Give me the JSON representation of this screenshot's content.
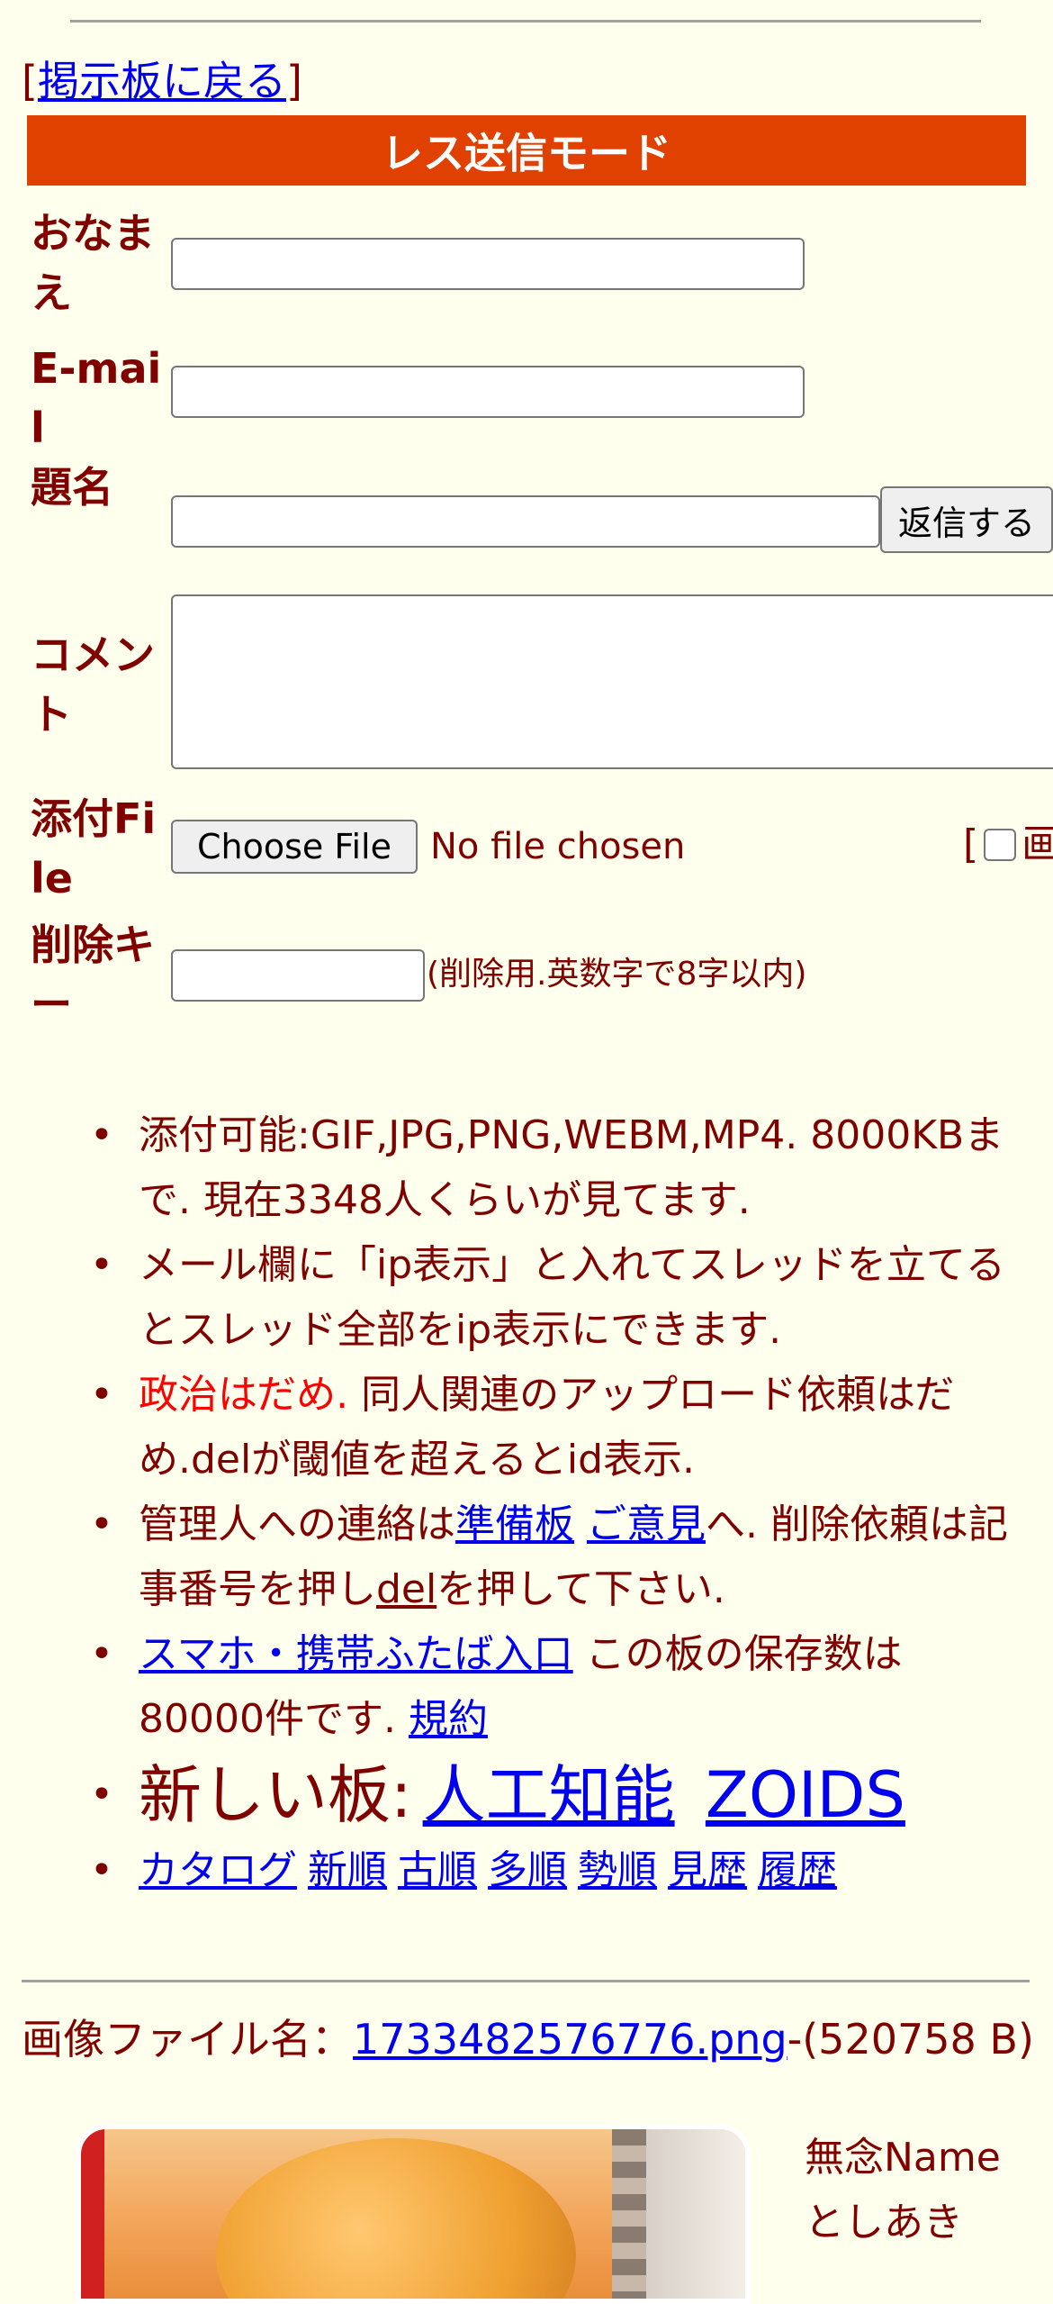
{
  "nav": {
    "back_open": "[",
    "back_link": "掲示板に戻る",
    "back_close": "]"
  },
  "mode_title": "レス送信モード",
  "form": {
    "name_label": "おなまえ",
    "email_label": "E-mail",
    "subject_label": "題名",
    "submit_label": "返信する",
    "comment_label": "コメント",
    "file_label": "添付File",
    "choose_file_label": "Choose File",
    "file_status": "No file chosen",
    "option_bracket": "[",
    "option_text": "画",
    "delete_key_label": "削除キー",
    "delete_key_hint": "(削除用.英数字で8字以内)"
  },
  "notes": {
    "item1": "添付可能:GIF,JPG,PNG,WEBM,MP4. 8000KBまで. 現在3348人くらいが見てます.",
    "item2": "メール欄に「ip表示」と入れてスレッドを立てるとスレッド全部をip表示にできます.",
    "item3_red": "政治はだめ.",
    "item3_rest": " 同人関連のアップロード依頼はだめ.delが閾値を超えるとid表示.",
    "item4_pre": "管理人への連絡は",
    "item4_link1": "準備板",
    "item4_link2": "ご意見",
    "item4_mid": "へ. 削除依頼は記事番号を押し",
    "item4_link3": "del",
    "item4_post": "を押して下さい.",
    "item5_link": "スマホ・携帯ふたば入口",
    "item5_text": " この板の保存数は80000件です. ",
    "item5_terms": "規約",
    "item6_label": "新しい板:",
    "item6_link1": "人工知能",
    "item6_link2": "ZOIDS",
    "item7_links": [
      "カタログ",
      "新順",
      "古順",
      "多順",
      "勢順",
      "見歴",
      "履歴"
    ]
  },
  "post": {
    "filename_label": "画像ファイル名：",
    "filename_link": "1733482576776.png",
    "filesize": "-(520758 B)",
    "name": "無念Name",
    "author": "としあき"
  },
  "colors": {
    "background": "#ffffee",
    "text": "#800000",
    "header_bar": "#e04000",
    "link": "#0000ee",
    "warning": "#ff0000"
  }
}
